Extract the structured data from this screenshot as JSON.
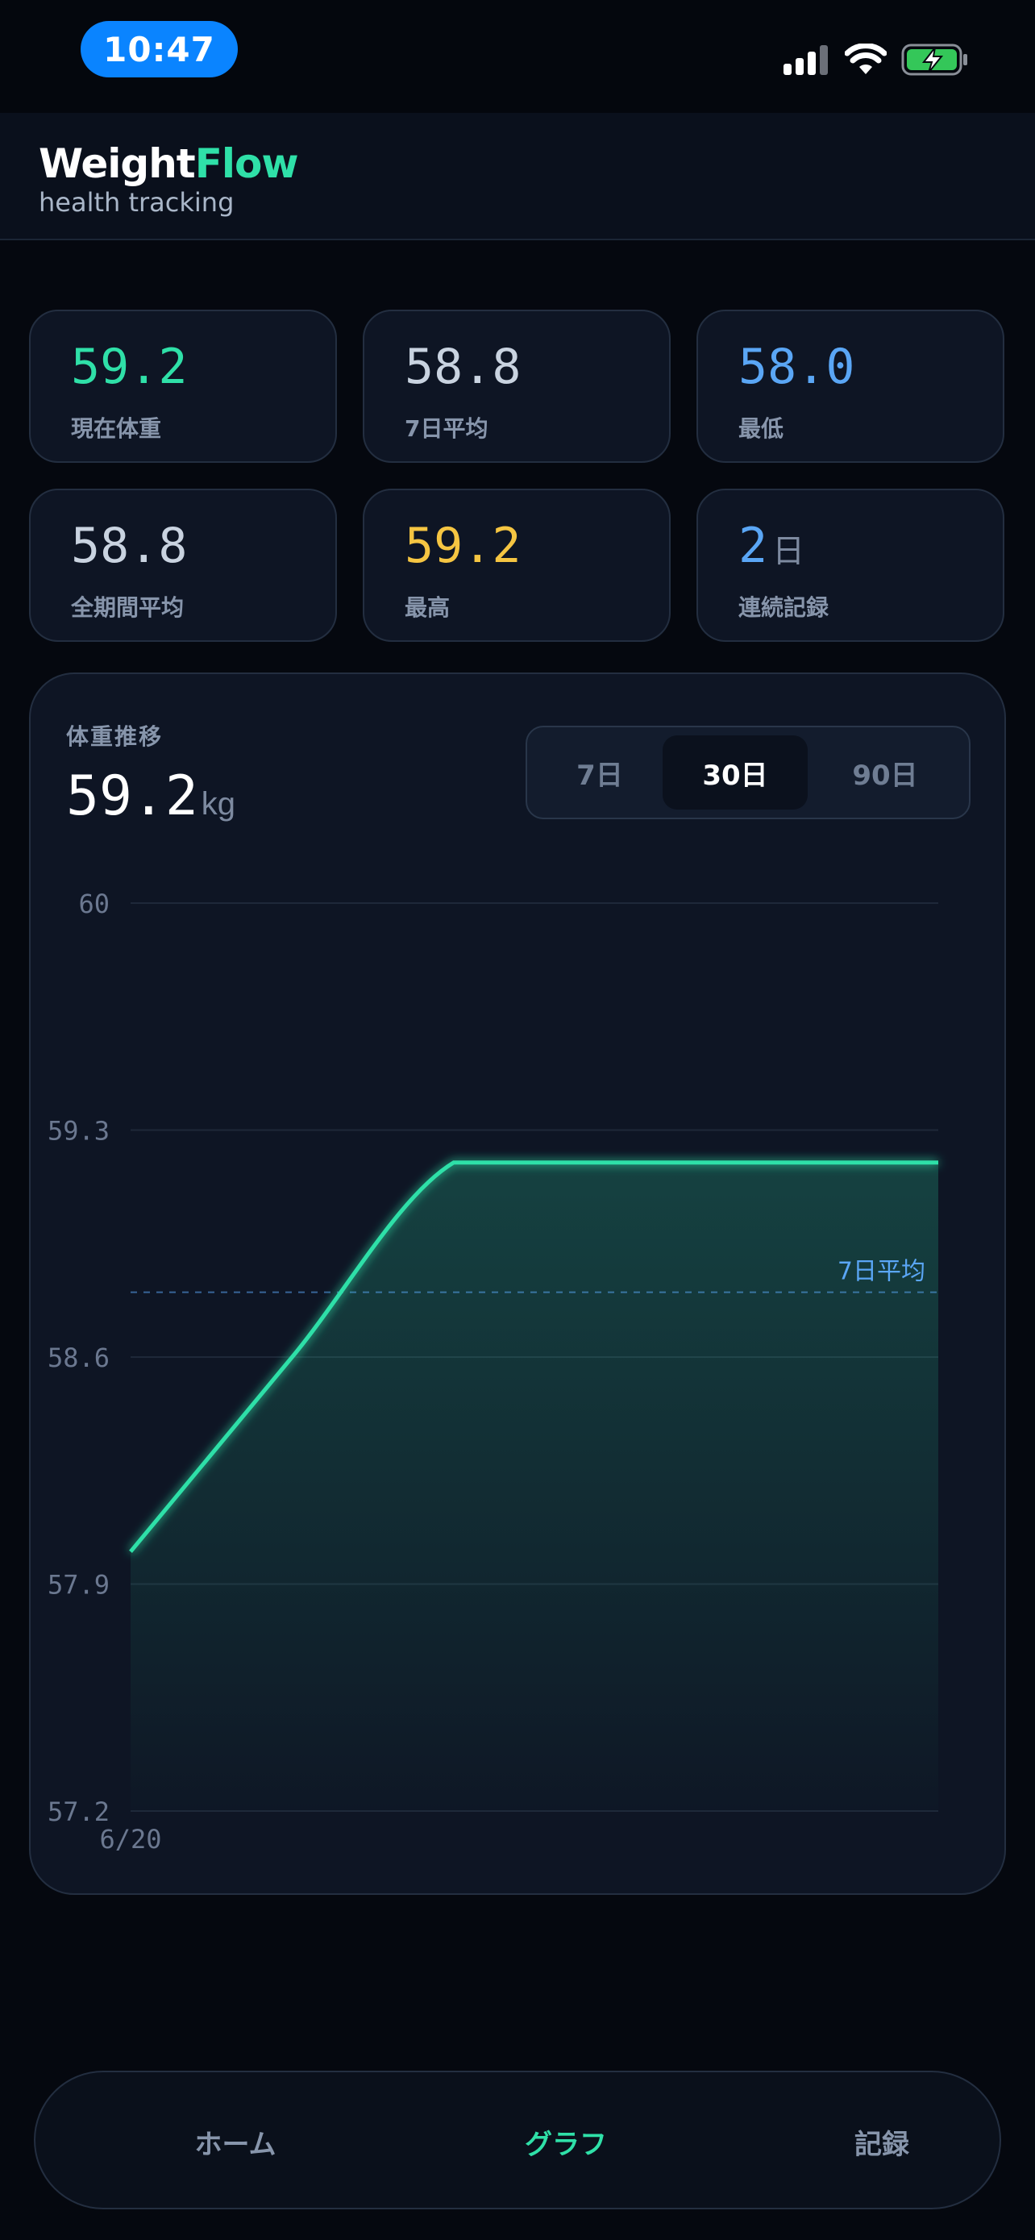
{
  "status_bar": {
    "time": "10:47"
  },
  "header": {
    "brand_part1": "Weight",
    "brand_part2": "Flow",
    "subtitle": "health tracking"
  },
  "stats": [
    {
      "value": "59.2",
      "unit": "",
      "label": "現在体重",
      "color": "#2fe0a8"
    },
    {
      "value": "58.8",
      "unit": "",
      "label": "7日平均",
      "color": "#c9d3e0"
    },
    {
      "value": "58.0",
      "unit": "",
      "label": "最低",
      "color": "#5aa6f5"
    },
    {
      "value": "58.8",
      "unit": "",
      "label": "全期間平均",
      "color": "#c9d3e0"
    },
    {
      "value": "59.2",
      "unit": "",
      "label": "最高",
      "color": "#f5c542"
    },
    {
      "value": "2",
      "unit": "日",
      "label": "連続記録",
      "color": "#5aa6f5"
    }
  ],
  "chart_card": {
    "title": "体重推移",
    "current_value": "59.2",
    "current_unit": "kg",
    "ranges": [
      "7日",
      "30日",
      "90日"
    ],
    "active_range": "30日"
  },
  "chart_data": {
    "type": "area",
    "x": [
      "6/20",
      "",
      "",
      "",
      "",
      ""
    ],
    "values": [
      58.0,
      58.6,
      59.2,
      59.2,
      59.2,
      59.2
    ],
    "ylim": [
      57.2,
      60.0
    ],
    "yticks": [
      "60",
      "59.3",
      "58.6",
      "57.9",
      "57.2"
    ],
    "ytick_values": [
      60.0,
      59.3,
      58.6,
      57.9,
      57.2
    ],
    "xtick_labels": [
      "6/20"
    ],
    "reference_line": {
      "value": 58.8,
      "label": "7日平均"
    },
    "grid": true,
    "line_color": "#2fe0a8",
    "reference_color": "#5aa6f5"
  },
  "bottom_nav": {
    "items": [
      "ホーム",
      "グラフ",
      "記録"
    ],
    "active": "グラフ"
  }
}
